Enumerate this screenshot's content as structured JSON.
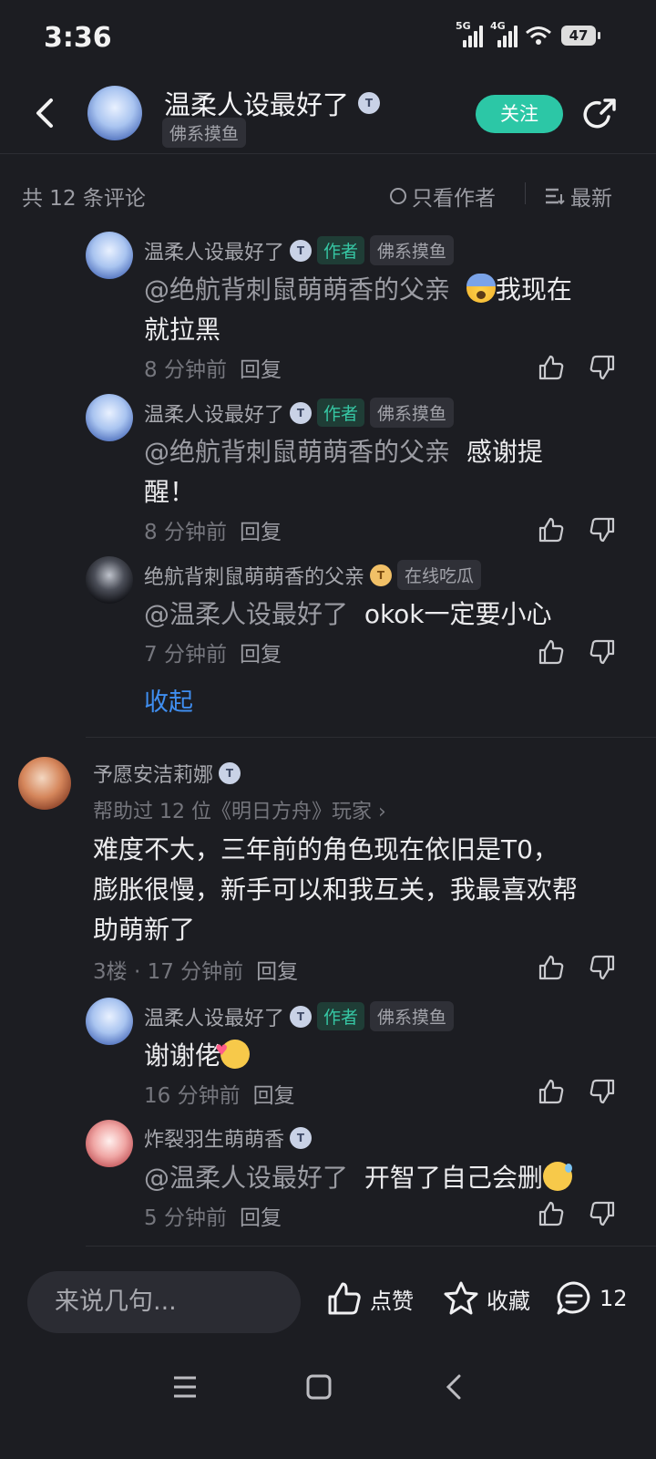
{
  "status_bar": {
    "time": "3:36",
    "net1": "5G",
    "net2": "4G",
    "battery": "47"
  },
  "header": {
    "title": "温柔人设最好了",
    "badge": "T",
    "tag": "佛系摸鱼",
    "follow": "关注"
  },
  "filter": {
    "count": "共 12 条评论",
    "author_only": "只看作者",
    "sort": "最新"
  },
  "comments": [
    {
      "name": "温柔人设最好了",
      "badge": "T",
      "author_tag": "作者",
      "tag": "佛系摸鱼",
      "mention": "@绝航背刺鼠萌萌香的父亲",
      "text1": "我现在",
      "text2": "就拉黑",
      "time": "8 分钟前",
      "reply": "回复"
    },
    {
      "name": "温柔人设最好了",
      "badge": "T",
      "author_tag": "作者",
      "tag": "佛系摸鱼",
      "mention": "@绝航背刺鼠萌萌香的父亲",
      "text1": "感谢提",
      "text2": "醒！",
      "time": "8 分钟前",
      "reply": "回复"
    },
    {
      "name": "绝航背刺鼠萌萌香的父亲",
      "badge": "T",
      "tag": "在线吃瓜",
      "mention": "@温柔人设最好了",
      "text1": "okok一定要小心",
      "time": "7 分钟前",
      "reply": "回复"
    },
    {
      "name": "予愿安洁莉娜",
      "badge": "T",
      "helped": "帮助过 12 位《明日方舟》玩家 ›",
      "line1": "难度不大，三年前的角色现在依旧是T0，",
      "line2": "膨胀很慢，新手可以和我互关，我最喜欢帮",
      "line3": "助萌新了",
      "floor": "3楼 · 17 分钟前",
      "reply": "回复"
    },
    {
      "name": "温柔人设最好了",
      "badge": "T",
      "author_tag": "作者",
      "tag": "佛系摸鱼",
      "text1": "谢谢佬",
      "time": "16 分钟前",
      "reply": "回复"
    },
    {
      "name": "炸裂羽生萌萌香",
      "badge": "T",
      "mention": "@温柔人设最好了",
      "text1": "开智了自己会删",
      "time": "5 分钟前",
      "reply": "回复"
    }
  ],
  "collapse": "收起",
  "bottom": {
    "placeholder": "来说几句...",
    "like": "点赞",
    "fav": "收藏",
    "comments": "12"
  },
  "colors": {
    "accent": "#2cc7a6",
    "link": "#3f8ef0",
    "bg": "#1c1d22"
  }
}
